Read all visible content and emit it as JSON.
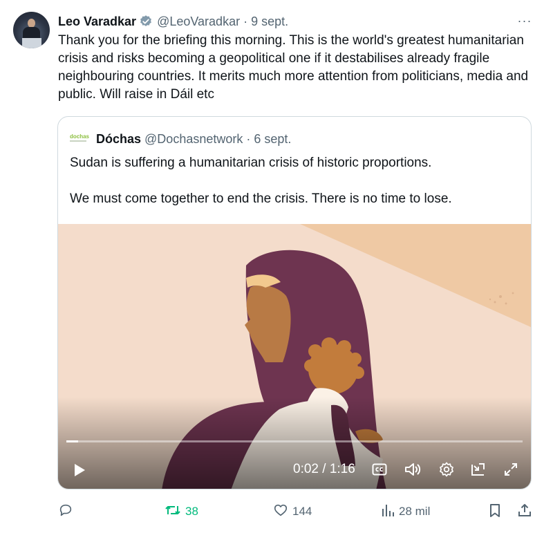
{
  "tweet": {
    "author_name": "Leo Varadkar",
    "handle": "@LeoVaradkar",
    "separator": "·",
    "date": "9 sept.",
    "more_label": "···",
    "text": "Thank you for the briefing this morning. This is the world's greatest humanitarian crisis and risks becoming a geopolitical one if it destabilises already fragile neighbouring countries.  It merits much more attention from politicians, media and public.  Will raise in Dáil etc"
  },
  "quoted": {
    "logo_text": "dochas",
    "author_name": "Dóchas",
    "handle": "@Dochasnetwork",
    "separator": "·",
    "date": "6 sept.",
    "text_line1": "Sudan is suffering a humanitarian crisis of historic proportions.",
    "text_line2": "We must come together to end the crisis. There is no time to lose.",
    "video": {
      "time_label": "0:02 / 1:16",
      "progress": 0.026
    }
  },
  "actions": {
    "retweets": "38",
    "likes": "144",
    "views": "28 mil"
  },
  "colors": {
    "text": "#0f1419",
    "secondary": "#536471",
    "verified": "#829aab",
    "retweet_green": "#00ba7c",
    "border": "#cfd9de"
  },
  "icons": [
    "verified-badge-icon",
    "more-icon",
    "play-icon",
    "closed-captions-icon",
    "volume-icon",
    "settings-icon",
    "picture-in-picture-icon",
    "fullscreen-icon",
    "reply-icon",
    "retweet-icon",
    "like-icon",
    "views-icon",
    "bookmark-icon",
    "share-icon"
  ]
}
